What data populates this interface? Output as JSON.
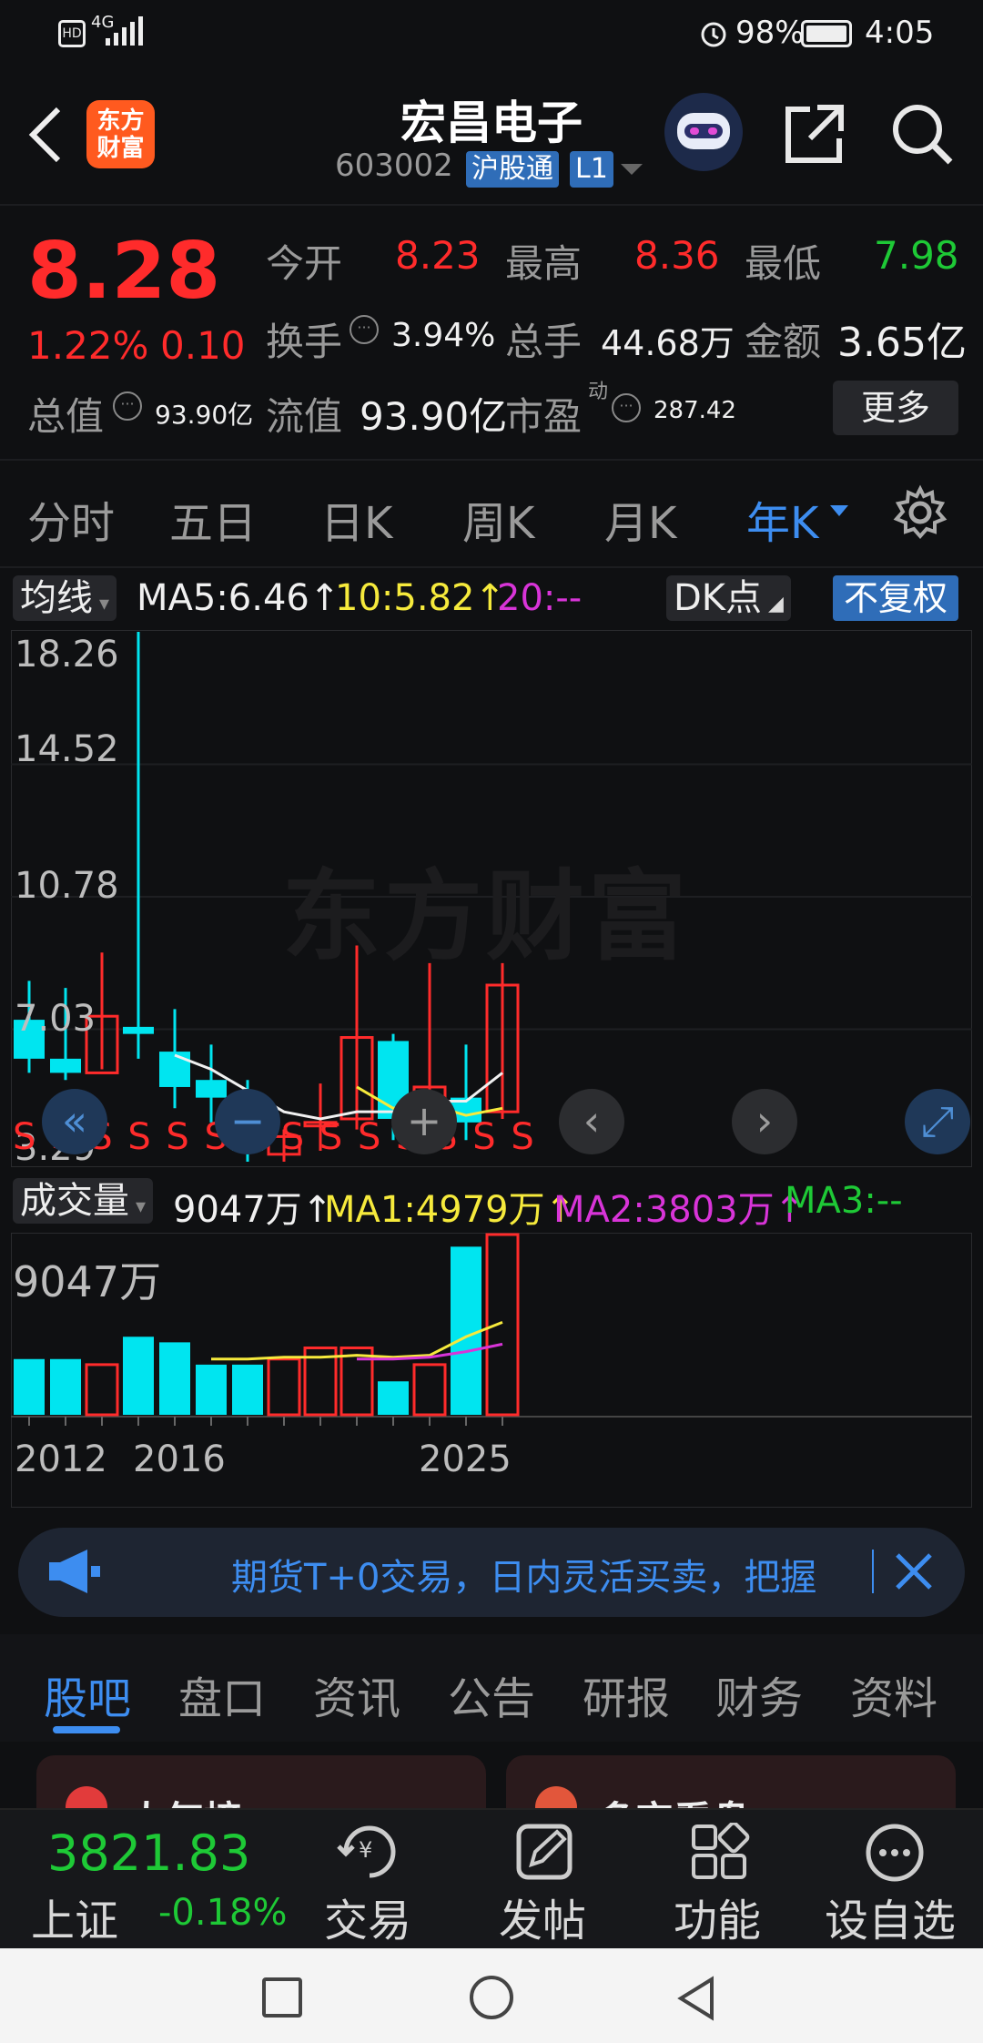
{
  "status_bar": {
    "network": "4G",
    "battery_text": "98%",
    "time": "4:05"
  },
  "header": {
    "logo_text": "东方\n财富",
    "title": "宏昌电子",
    "code": "603002",
    "tag1": "沪股通",
    "tag2": "L1"
  },
  "quote": {
    "price": "8.28",
    "change_pct": "1.22%",
    "change_abs": "0.10",
    "open_label": "今开",
    "open": "8.23",
    "high_label": "最高",
    "high": "8.36",
    "low_label": "最低",
    "low": "7.98",
    "turnover_label": "换手",
    "turnover": "3.94%",
    "volume_label": "总手",
    "volume": "44.68万",
    "amount_label": "金额",
    "amount": "3.65亿",
    "mktcap_label": "总值",
    "mktcap": "93.90亿",
    "float_label": "流值",
    "float": "93.90亿",
    "pe_label": "市盈",
    "pe_sup": "动",
    "pe": "287.42",
    "more_button": "更多"
  },
  "period_tabs": [
    "分时",
    "五日",
    "日K",
    "周K",
    "月K",
    "年K"
  ],
  "active_tab": "年K",
  "chart_toolbar": {
    "ma_select": "均线",
    "ma5": "MA5:6.46↑",
    "ma10": "10:5.82↑",
    "ma20": "20:--",
    "dk_select": "DK点",
    "adjust": "不复权"
  },
  "price_axis": [
    "18.26",
    "14.52",
    "10.78",
    "7.03",
    "3.29"
  ],
  "watermark": "东方财富",
  "volume_toolbar": {
    "select": "成交量",
    "vol": "9047万↑",
    "ma1": "MA1:4979万↑",
    "ma2": "MA2:3803万↑",
    "ma3": "MA3:--"
  },
  "volume_axis_top": "9047万",
  "x_axis_labels": [
    "2012",
    "2016",
    "2025"
  ],
  "banner_text": "期货T+0交易，日内灵活买卖，把握",
  "news_tabs": [
    "股吧",
    "盘口",
    "资讯",
    "公告",
    "研报",
    "财务",
    "资料"
  ],
  "news_active": "股吧",
  "cards": [
    "人气榜",
    "多空看盘"
  ],
  "bottom_nav": {
    "index_value": "3821.83",
    "index_name": "上证",
    "index_change": "-0.18%",
    "items": [
      "交易",
      "发帖",
      "功能",
      "设自选"
    ]
  },
  "colors": {
    "up": "#ff2b2b",
    "down": "#1ec936",
    "accent": "#3d8df0",
    "cyan": "#00e5f0"
  },
  "chart_data": {
    "type": "candlestick",
    "period": "year",
    "x": [
      "2012",
      "2013",
      "2014",
      "2015",
      "2016",
      "2017",
      "2018",
      "2019",
      "2020",
      "2021",
      "2022",
      "2023",
      "2024",
      "2025"
    ],
    "ohlc": [
      [
        7.3,
        8.4,
        5.8,
        6.2
      ],
      [
        6.2,
        8.2,
        5.6,
        5.8
      ],
      [
        5.8,
        9.2,
        5.9,
        7.4
      ],
      [
        7.1,
        18.26,
        6.2,
        6.9
      ],
      [
        6.4,
        7.6,
        4.8,
        5.4
      ],
      [
        5.6,
        6.6,
        4.4,
        5.1
      ],
      [
        4.9,
        5.6,
        3.29,
        3.6
      ],
      [
        3.5,
        4.2,
        3.29,
        4.0
      ],
      [
        4.3,
        5.5,
        3.6,
        4.4
      ],
      [
        4.5,
        9.4,
        4.2,
        6.8
      ],
      [
        6.7,
        6.9,
        3.9,
        4.5
      ],
      [
        4.6,
        8.9,
        4.1,
        5.4
      ],
      [
        5.1,
        6.6,
        3.9,
        4.4
      ],
      [
        4.7,
        8.9,
        4.5,
        8.28
      ]
    ],
    "ma5": [
      null,
      null,
      null,
      null,
      6.3,
      5.9,
      5.3,
      4.7,
      4.5,
      4.7,
      4.7,
      5.0,
      5.0,
      5.8
    ],
    "ma10": [
      null,
      null,
      null,
      null,
      null,
      null,
      null,
      null,
      null,
      5.4,
      4.8,
      4.9,
      4.6,
      4.8
    ],
    "volume_wan": [
      3000,
      3000,
      2700,
      4200,
      3900,
      2700,
      2700,
      3000,
      3600,
      3600,
      1800,
      2700,
      9047,
      9700
    ],
    "vol_ma1": [
      null,
      null,
      null,
      null,
      null,
      3000,
      3000,
      3100,
      3100,
      3200,
      3100,
      3200,
      4200,
      4979
    ],
    "vol_ma2": [
      null,
      null,
      null,
      null,
      null,
      null,
      null,
      null,
      null,
      3000,
      3000,
      3100,
      3400,
      3803
    ],
    "ylim": [
      3.29,
      18.26
    ]
  }
}
